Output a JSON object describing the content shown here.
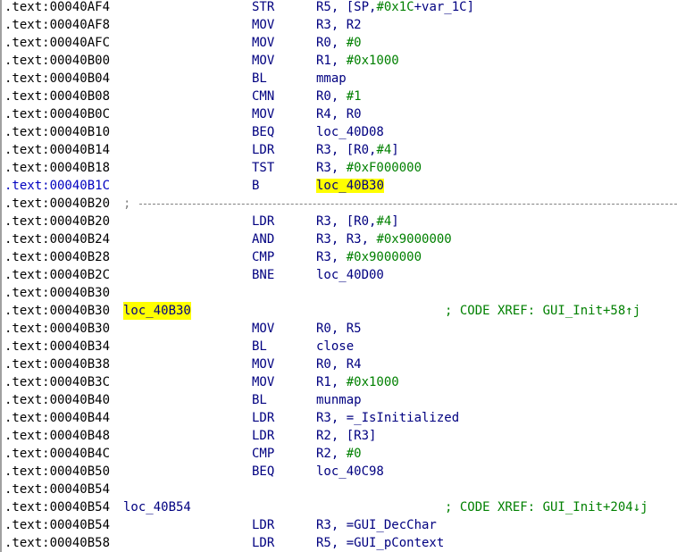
{
  "rows": [
    {
      "seg": ".text:",
      "addr": "00040AF4",
      "label": "",
      "mn": "STR",
      "ops": [
        {
          "t": "R5, [SP,"
        },
        {
          "t": "#0x1C",
          "n": 1
        },
        {
          "t": "+var_1C]"
        }
      ]
    },
    {
      "seg": ".text:",
      "addr": "00040AF8",
      "label": "",
      "mn": "MOV",
      "ops": [
        {
          "t": "R3, R2"
        }
      ]
    },
    {
      "seg": ".text:",
      "addr": "00040AFC",
      "label": "",
      "mn": "MOV",
      "ops": [
        {
          "t": "R0, "
        },
        {
          "t": "#0",
          "n": 1
        }
      ]
    },
    {
      "seg": ".text:",
      "addr": "00040B00",
      "label": "",
      "mn": "MOV",
      "ops": [
        {
          "t": "R1, "
        },
        {
          "t": "#0x1000",
          "n": 1
        }
      ]
    },
    {
      "seg": ".text:",
      "addr": "00040B04",
      "label": "",
      "mn": "BL",
      "ops": [
        {
          "t": "mmap"
        }
      ]
    },
    {
      "seg": ".text:",
      "addr": "00040B08",
      "label": "",
      "mn": "CMN",
      "ops": [
        {
          "t": "R0, "
        },
        {
          "t": "#1",
          "n": 1
        }
      ]
    },
    {
      "seg": ".text:",
      "addr": "00040B0C",
      "label": "",
      "mn": "MOV",
      "ops": [
        {
          "t": "R4, R0"
        }
      ]
    },
    {
      "seg": ".text:",
      "addr": "00040B10",
      "label": "",
      "mn": "BEQ",
      "ops": [
        {
          "t": "loc_40D08"
        }
      ]
    },
    {
      "seg": ".text:",
      "addr": "00040B14",
      "label": "",
      "mn": "LDR",
      "ops": [
        {
          "t": "R3, [R0,"
        },
        {
          "t": "#4",
          "n": 1
        },
        {
          "t": "]"
        }
      ]
    },
    {
      "seg": ".text:",
      "addr": "00040B18",
      "label": "",
      "mn": "TST",
      "ops": [
        {
          "t": "R3, "
        },
        {
          "t": "#0xF000000",
          "n": 1
        }
      ]
    },
    {
      "seg": ".text:",
      "addr": "00040B1C",
      "label": "",
      "mn": "B",
      "ops": [
        {
          "t": "loc_40B3",
          "h": 1
        },
        {
          "cursor": 1
        },
        {
          "t": "0",
          "h": 1
        }
      ],
      "current": 1
    },
    {
      "seg": ".text:",
      "addr": "00040B20",
      "sep": 1,
      "sep_text": ";"
    },
    {
      "seg": ".text:",
      "addr": "00040B20",
      "label": "",
      "mn": "LDR",
      "ops": [
        {
          "t": "R3, [R0,"
        },
        {
          "t": "#4",
          "n": 1
        },
        {
          "t": "]"
        }
      ]
    },
    {
      "seg": ".text:",
      "addr": "00040B24",
      "label": "",
      "mn": "AND",
      "ops": [
        {
          "t": "R3, R3, "
        },
        {
          "t": "#0x9000000",
          "n": 1
        }
      ]
    },
    {
      "seg": ".text:",
      "addr": "00040B28",
      "label": "",
      "mn": "CMP",
      "ops": [
        {
          "t": "R3, "
        },
        {
          "t": "#0x9000000",
          "n": 1
        }
      ]
    },
    {
      "seg": ".text:",
      "addr": "00040B2C",
      "label": "",
      "mn": "BNE",
      "ops": [
        {
          "t": "loc_40D00"
        }
      ]
    },
    {
      "seg": ".text:",
      "addr": "00040B30",
      "label": "",
      "mn": "",
      "ops": []
    },
    {
      "seg": ".text:",
      "addr": "00040B30",
      "label": "loc_40B30",
      "label_hl": 1,
      "mn": "",
      "ops": [],
      "comment": "; CODE XREF: GUI_Init+58↑j"
    },
    {
      "seg": ".text:",
      "addr": "00040B30",
      "label": "",
      "mn": "MOV",
      "ops": [
        {
          "t": "R0, R5"
        }
      ]
    },
    {
      "seg": ".text:",
      "addr": "00040B34",
      "label": "",
      "mn": "BL",
      "ops": [
        {
          "t": "close"
        }
      ]
    },
    {
      "seg": ".text:",
      "addr": "00040B38",
      "label": "",
      "mn": "MOV",
      "ops": [
        {
          "t": "R0, R4"
        }
      ]
    },
    {
      "seg": ".text:",
      "addr": "00040B3C",
      "label": "",
      "mn": "MOV",
      "ops": [
        {
          "t": "R1, "
        },
        {
          "t": "#0x1000",
          "n": 1
        }
      ]
    },
    {
      "seg": ".text:",
      "addr": "00040B40",
      "label": "",
      "mn": "BL",
      "ops": [
        {
          "t": "munmap"
        }
      ]
    },
    {
      "seg": ".text:",
      "addr": "00040B44",
      "label": "",
      "mn": "LDR",
      "ops": [
        {
          "t": "R3, =_IsInitialized"
        }
      ]
    },
    {
      "seg": ".text:",
      "addr": "00040B48",
      "label": "",
      "mn": "LDR",
      "ops": [
        {
          "t": "R2, [R3]"
        }
      ]
    },
    {
      "seg": ".text:",
      "addr": "00040B4C",
      "label": "",
      "mn": "CMP",
      "ops": [
        {
          "t": "R2, "
        },
        {
          "t": "#0",
          "n": 1
        }
      ]
    },
    {
      "seg": ".text:",
      "addr": "00040B50",
      "label": "",
      "mn": "BEQ",
      "ops": [
        {
          "t": "loc_40C98"
        }
      ]
    },
    {
      "seg": ".text:",
      "addr": "00040B54",
      "label": "",
      "mn": "",
      "ops": []
    },
    {
      "seg": ".text:",
      "addr": "00040B54",
      "label": "loc_40B54",
      "mn": "",
      "ops": [],
      "comment": "; CODE XREF: GUI_Init+204↓j"
    },
    {
      "seg": ".text:",
      "addr": "00040B54",
      "label": "",
      "mn": "LDR",
      "ops": [
        {
          "t": "R3, =GUI_DecChar"
        }
      ]
    },
    {
      "seg": ".text:",
      "addr": "00040B58",
      "label": "",
      "mn": "LDR",
      "ops": [
        {
          "t": "R5, =GUI_pContext"
        }
      ]
    }
  ],
  "colors": {
    "text": "#000080",
    "number": "#008000",
    "comment": "#008000",
    "highlight": "#ffff00",
    "address": "#000000"
  }
}
